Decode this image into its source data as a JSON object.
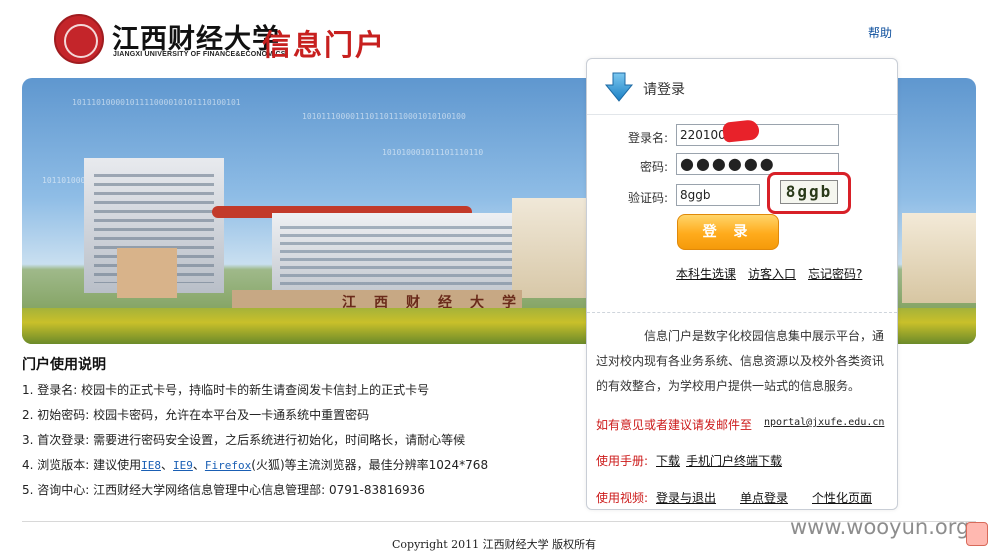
{
  "header": {
    "university_cn": "江西财经大学",
    "university_en": "JIANGXI UNIVERSITY OF FINANCE&ECONOMICS",
    "portal_title": "信息门户",
    "help": "帮助"
  },
  "banner": {
    "wall_text": "江西财经大学",
    "binary_lines": [
      "10111010000101111000010101110100101",
      "1010111000011101101110001010100100",
      "101101000011110001011000101",
      "101010001011101110110"
    ]
  },
  "login": {
    "title": "请登录",
    "username_label": "登录名:",
    "username_value": "220100",
    "password_label": "密码:",
    "password_value": "●●●●●●",
    "captcha_label": "验证码:",
    "captcha_value": "8ggb",
    "captcha_image_text": "8ggb",
    "submit": "登 录",
    "links": [
      "本科生选课",
      "访客入口",
      "忘记密码?"
    ],
    "intro": "信息门户是数字化校园信息集中展示平台，通过对校内现有各业务系统、信息资源以及校外各类资讯的有效整合，为学校用户提供一站式的信息服务。",
    "feedback_label": "如有意见或者建议请发邮件至",
    "feedback_email": "nportal@jxufe.edu.cn",
    "manual_label": "使用手册:",
    "manual_links": [
      "下载",
      "手机门户终端下载"
    ],
    "video_label": "使用视频:",
    "video_links": [
      "登录与退出",
      "单点登录",
      "个性化页面"
    ]
  },
  "usage": {
    "title": "门户使用说明",
    "items": [
      {
        "text": "1. 登录名: 校园卡的正式卡号，持临时卡的新生请查阅发卡信封上的正式卡号"
      },
      {
        "text": "2. 初始密码: 校园卡密码，允许在本平台及一卡通系统中重置密码"
      },
      {
        "text": "3. 首次登录: 需要进行密码安全设置，之后系统进行初始化，时间略长，请耐心等候"
      },
      {
        "prefix": "4. 浏览版本: 建议使用",
        "links": [
          "IE8",
          "IE9",
          "Firefox"
        ],
        "suffix": "(火狐)等主流浏览器，最佳分辨率1024*768"
      },
      {
        "text": "5. 咨询中心: 江西财经大学网络信息管理中心信息管理部: 0791-83816936"
      }
    ]
  },
  "footer": {
    "copyright": "Copyright 2011 江西财经大学 版权所有",
    "watermark": "www.wooyun.org"
  }
}
